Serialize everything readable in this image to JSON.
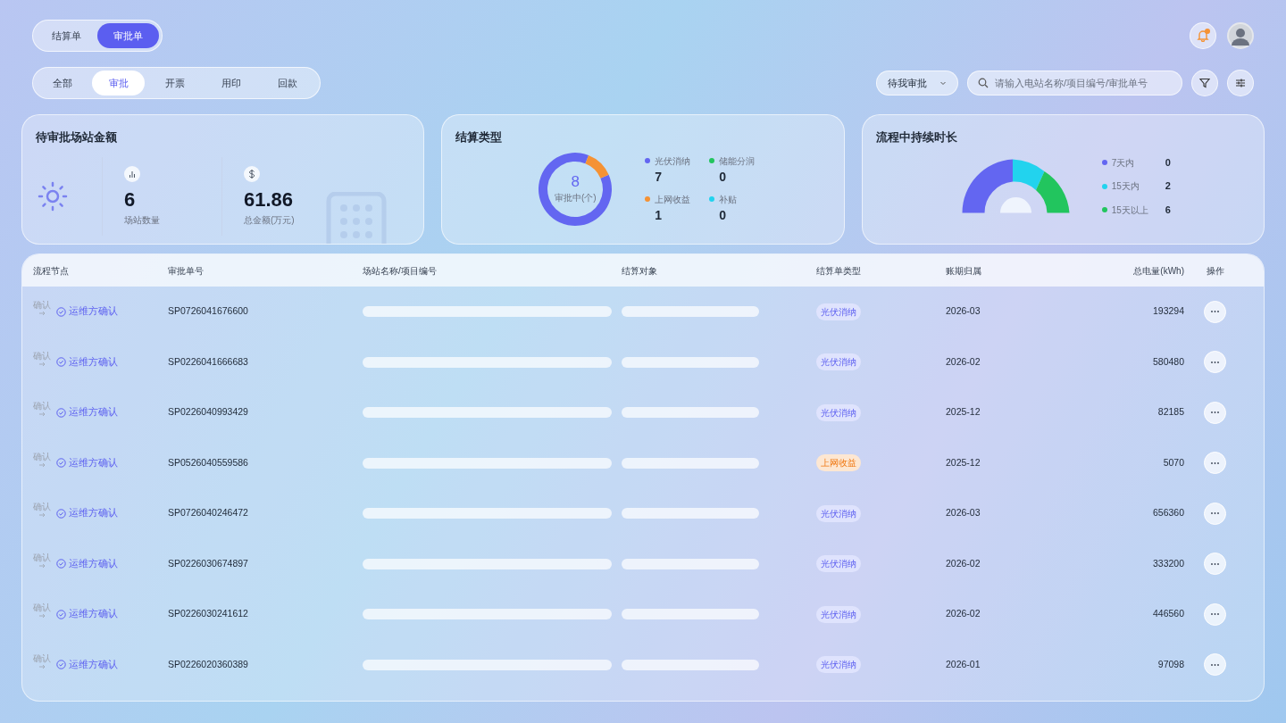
{
  "doc_tabs": [
    {
      "label": "结算单",
      "selected": false
    },
    {
      "label": "审批单",
      "selected": true
    }
  ],
  "filter_tabs": [
    {
      "label": "全部",
      "selected": false
    },
    {
      "label": "审批",
      "selected": true
    },
    {
      "label": "开票",
      "selected": false
    },
    {
      "label": "用印",
      "selected": false
    },
    {
      "label": "回款",
      "selected": false
    }
  ],
  "notifications": {
    "unread": true
  },
  "status_select": {
    "value": "待我审批"
  },
  "search": {
    "placeholder": "请输入电站名称/项目编号/审批单号"
  },
  "cards": {
    "amount": {
      "title": "待审批场站金额",
      "stats": [
        {
          "kind": "count",
          "value": "6",
          "label": "场站数量"
        },
        {
          "kind": "money",
          "value": "61.86",
          "label": "总金额(万元)"
        }
      ]
    },
    "settlement": {
      "title": "结算类型",
      "center_value": "8",
      "center_label": "审批中(个)",
      "legend": [
        {
          "label": "光伏消纳",
          "value": "7",
          "color": "#6366f1"
        },
        {
          "label": "储能分润",
          "value": "0",
          "color": "#22c55e"
        },
        {
          "label": "上网收益",
          "value": "1",
          "color": "#f59234"
        },
        {
          "label": "补贴",
          "value": "0",
          "color": "#22d3ee"
        }
      ]
    },
    "duration": {
      "title": "流程中持续时长",
      "legend": [
        {
          "label": "7天内",
          "value": "0",
          "color": "#6366f1"
        },
        {
          "label": "15天内",
          "value": "2",
          "color": "#22d3ee"
        },
        {
          "label": "15天以上",
          "value": "6",
          "color": "#22c55e"
        }
      ]
    }
  },
  "table": {
    "columns": [
      "流程节点",
      "审批单号",
      "场站名称/项目编号",
      "结算对象",
      "结算单类型",
      "账期归属",
      "总电量(kWh)",
      "操作"
    ],
    "rows": [
      {
        "prev_node": "确认",
        "node": "运维方确认",
        "id": "SP0726041676600",
        "type": {
          "label": "光伏消纳",
          "kind": "pv"
        },
        "period": "2026-03",
        "energy": "193294"
      },
      {
        "prev_node": "确认",
        "node": "运维方确认",
        "id": "SP0226041666683",
        "type": {
          "label": "光伏消纳",
          "kind": "pv"
        },
        "period": "2026-02",
        "energy": "580480"
      },
      {
        "prev_node": "确认",
        "node": "运维方确认",
        "id": "SP0226040993429",
        "type": {
          "label": "光伏消纳",
          "kind": "pv"
        },
        "period": "2025-12",
        "energy": "82185"
      },
      {
        "prev_node": "确认",
        "node": "运维方确认",
        "id": "SP0526040559586",
        "type": {
          "label": "上网收益",
          "kind": "grid"
        },
        "period": "2025-12",
        "energy": "5070"
      },
      {
        "prev_node": "确认",
        "node": "运维方确认",
        "id": "SP0726040246472",
        "type": {
          "label": "光伏消纳",
          "kind": "pv"
        },
        "period": "2026-03",
        "energy": "656360"
      },
      {
        "prev_node": "确认",
        "node": "运维方确认",
        "id": "SP0226030674897",
        "type": {
          "label": "光伏消纳",
          "kind": "pv"
        },
        "period": "2026-02",
        "energy": "333200"
      },
      {
        "prev_node": "确认",
        "node": "运维方确认",
        "id": "SP0226030241612",
        "type": {
          "label": "光伏消纳",
          "kind": "pv"
        },
        "period": "2026-02",
        "energy": "446560"
      },
      {
        "prev_node": "确认",
        "node": "运维方确认",
        "id": "SP0226020360389",
        "type": {
          "label": "光伏消纳",
          "kind": "pv"
        },
        "period": "2026-01",
        "energy": "97098"
      }
    ]
  }
}
